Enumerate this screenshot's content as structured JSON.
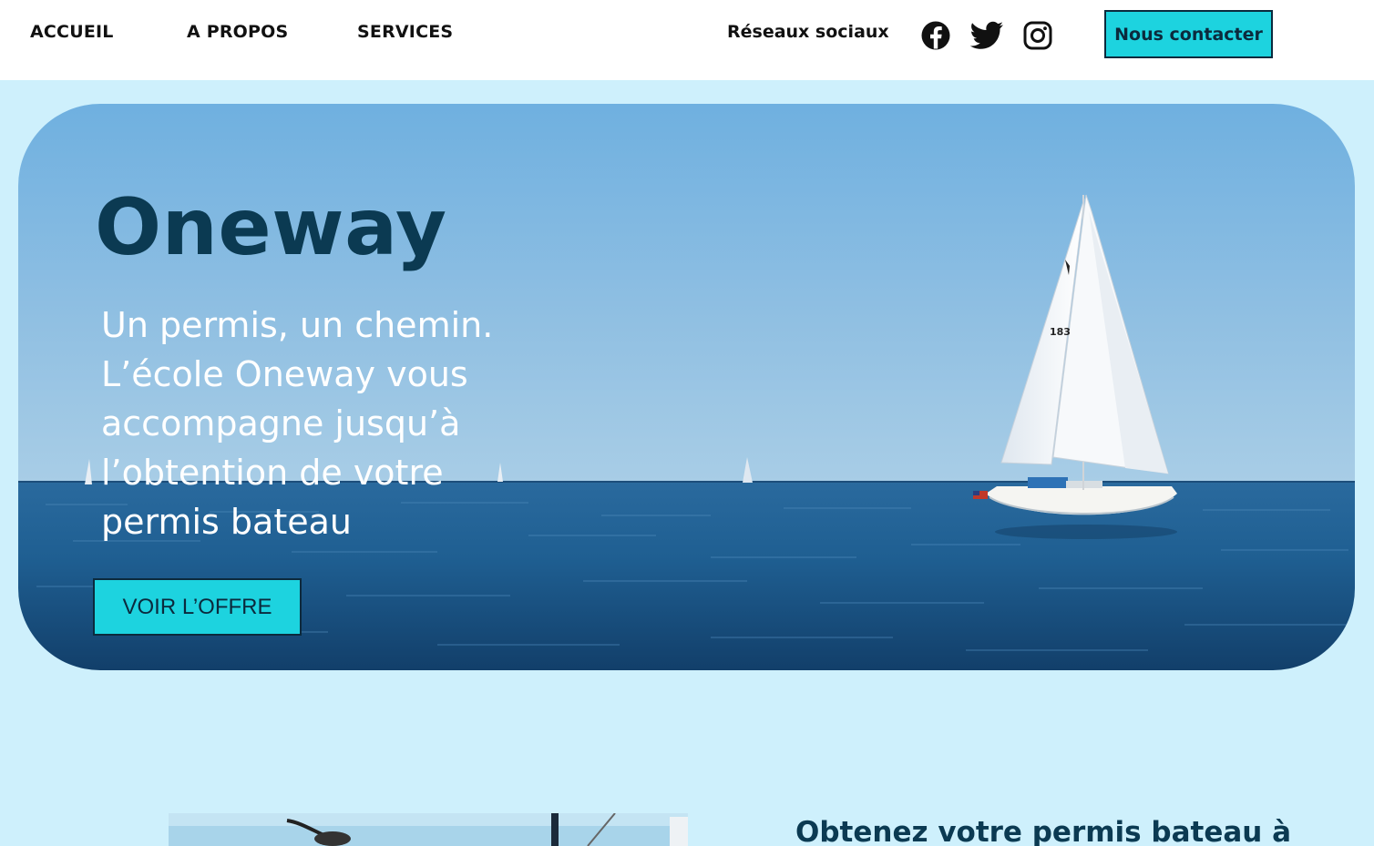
{
  "nav": {
    "links": [
      "ACCUEIL",
      "A PROPOS",
      "SERVICES"
    ],
    "social_label": "Réseaux sociaux",
    "social_icons": [
      "facebook-icon",
      "twitter-icon",
      "instagram-icon"
    ],
    "contact_label": "Nous contacter"
  },
  "hero": {
    "title": "Oneway",
    "tagline": "Un permis, un chemin. L’école Oneway vous accompagne jusqu’à l’obtention de votre permis bateau",
    "cta_label": "VOIR L’OFFRE",
    "sail_number": "183"
  },
  "section": {
    "heading": "Obtenez votre permis bateau à"
  },
  "colors": {
    "accent": "#1dd3df",
    "page_bg": "#cef0fc",
    "dark_text": "#0b3a52",
    "border": "#0b2a3d"
  }
}
